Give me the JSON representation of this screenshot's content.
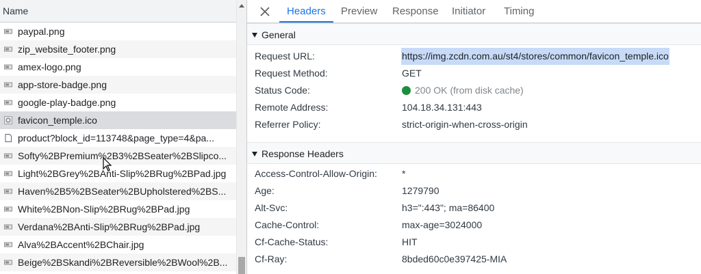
{
  "request_list": {
    "column_name": "Name",
    "rows": [
      {
        "name": "paypal.png",
        "icon": "image-file-icon",
        "selected": false
      },
      {
        "name": "zip_website_footer.png",
        "icon": "image-file-icon",
        "selected": false
      },
      {
        "name": "amex-logo.png",
        "icon": "image-file-icon",
        "selected": false
      },
      {
        "name": "app-store-badge.png",
        "icon": "image-file-icon",
        "selected": false
      },
      {
        "name": "google-play-badge.png",
        "icon": "image-file-icon",
        "selected": false
      },
      {
        "name": "favicon_temple.ico",
        "icon": "favicon-file-icon",
        "selected": true
      },
      {
        "name": "product?block_id=113748&page_type=4&pa...",
        "icon": "document-file-icon",
        "selected": false
      },
      {
        "name": "Softy%2BPremium%2B3%2BSeater%2BSlipco...",
        "icon": "image-file-icon",
        "selected": false
      },
      {
        "name": "Light%2BGrey%2BAnti-Slip%2BRug%2BPad.jpg",
        "icon": "image-file-icon",
        "selected": false
      },
      {
        "name": "Haven%2B5%2BSeater%2BUpholstered%2BS...",
        "icon": "image-file-icon",
        "selected": false
      },
      {
        "name": "White%2BNon-Slip%2BRug%2BPad.jpg",
        "icon": "image-file-icon",
        "selected": false
      },
      {
        "name": "Verdana%2BAnti-Slip%2BRug%2BPad.jpg",
        "icon": "image-file-icon",
        "selected": false
      },
      {
        "name": "Alva%2BAccent%2BChair.jpg",
        "icon": "image-file-icon",
        "selected": false
      },
      {
        "name": "Beige%2BSkandi%2BReversible%2BWool%2B...",
        "icon": "image-file-icon",
        "selected": false
      }
    ]
  },
  "tabs": {
    "headers": "Headers",
    "preview": "Preview",
    "response": "Response",
    "initiator": "Initiator",
    "timing": "Timing",
    "active": "Headers"
  },
  "general": {
    "title": "General",
    "request_url_label": "Request URL:",
    "request_url": "https://img.zcdn.com.au/st4/stores/common/favicon_temple.ico",
    "request_method_label": "Request Method:",
    "request_method": "GET",
    "status_code_label": "Status Code:",
    "status_code": "200 OK (from disk cache)",
    "remote_address_label": "Remote Address:",
    "remote_address": "104.18.34.131:443",
    "referrer_policy_label": "Referrer Policy:",
    "referrer_policy": "strict-origin-when-cross-origin"
  },
  "response_headers": {
    "title": "Response Headers",
    "items": [
      {
        "key": "Access-Control-Allow-Origin:",
        "value": "*"
      },
      {
        "key": "Age:",
        "value": "1279790"
      },
      {
        "key": "Alt-Svc:",
        "value": "h3=\":443\"; ma=86400"
      },
      {
        "key": "Cache-Control:",
        "value": "max-age=3024000"
      },
      {
        "key": "Cf-Cache-Status:",
        "value": "HIT"
      },
      {
        "key": "Cf-Ray:",
        "value": "8bded60c0e397425-MIA"
      }
    ]
  },
  "colors": {
    "accent": "#1a73e8",
    "status_ok": "#1e8e3e",
    "selected_row": "#dadce0",
    "url_highlight": "#c7dbf8"
  }
}
